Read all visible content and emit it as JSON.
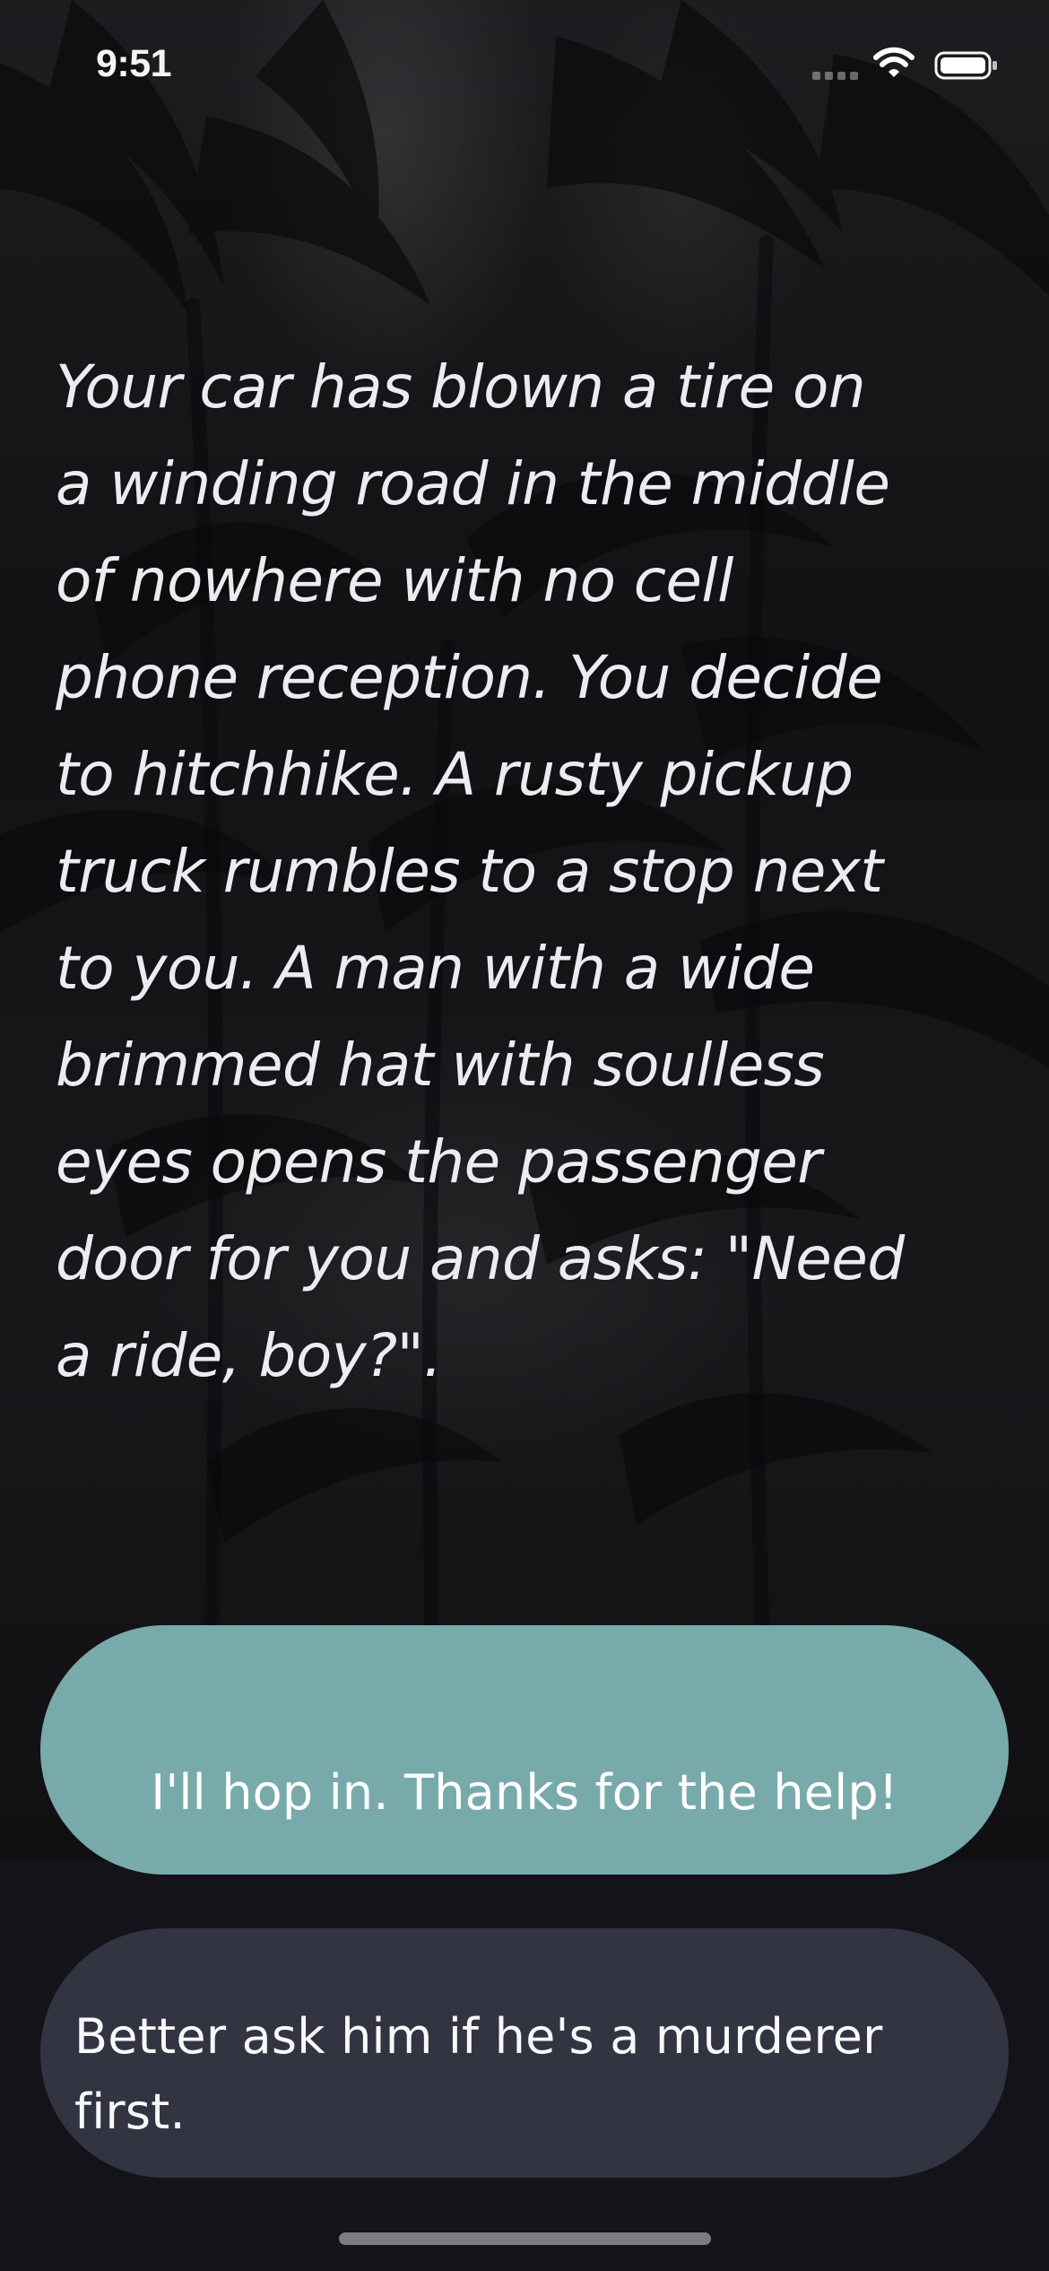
{
  "status_bar": {
    "time": "9:51"
  },
  "icons": {
    "signal": "cellular-signal-empty-icon",
    "wifi": "wifi-icon",
    "battery": "battery-full-icon"
  },
  "story": {
    "text": "Your car has blown a tire on\na winding road in the middle\nof nowhere with no cell\nphone reception. You decide\nto hitchhike. A rusty pickup\ntruck rumbles to a stop next\nto you. A man with a wide\nbrimmed hat with soulless\neyes opens the passenger\ndoor for you and asks: \"Need\na ride, boy?\"."
  },
  "choices": {
    "primary_label": "I'll hop in. Thanks for the help!",
    "secondary_label": "Better ask him if he's a murderer first."
  },
  "colors": {
    "primary_choice": "#79aaab",
    "secondary_choice": "#323541",
    "text": "#ececf0",
    "background": "#141319"
  }
}
